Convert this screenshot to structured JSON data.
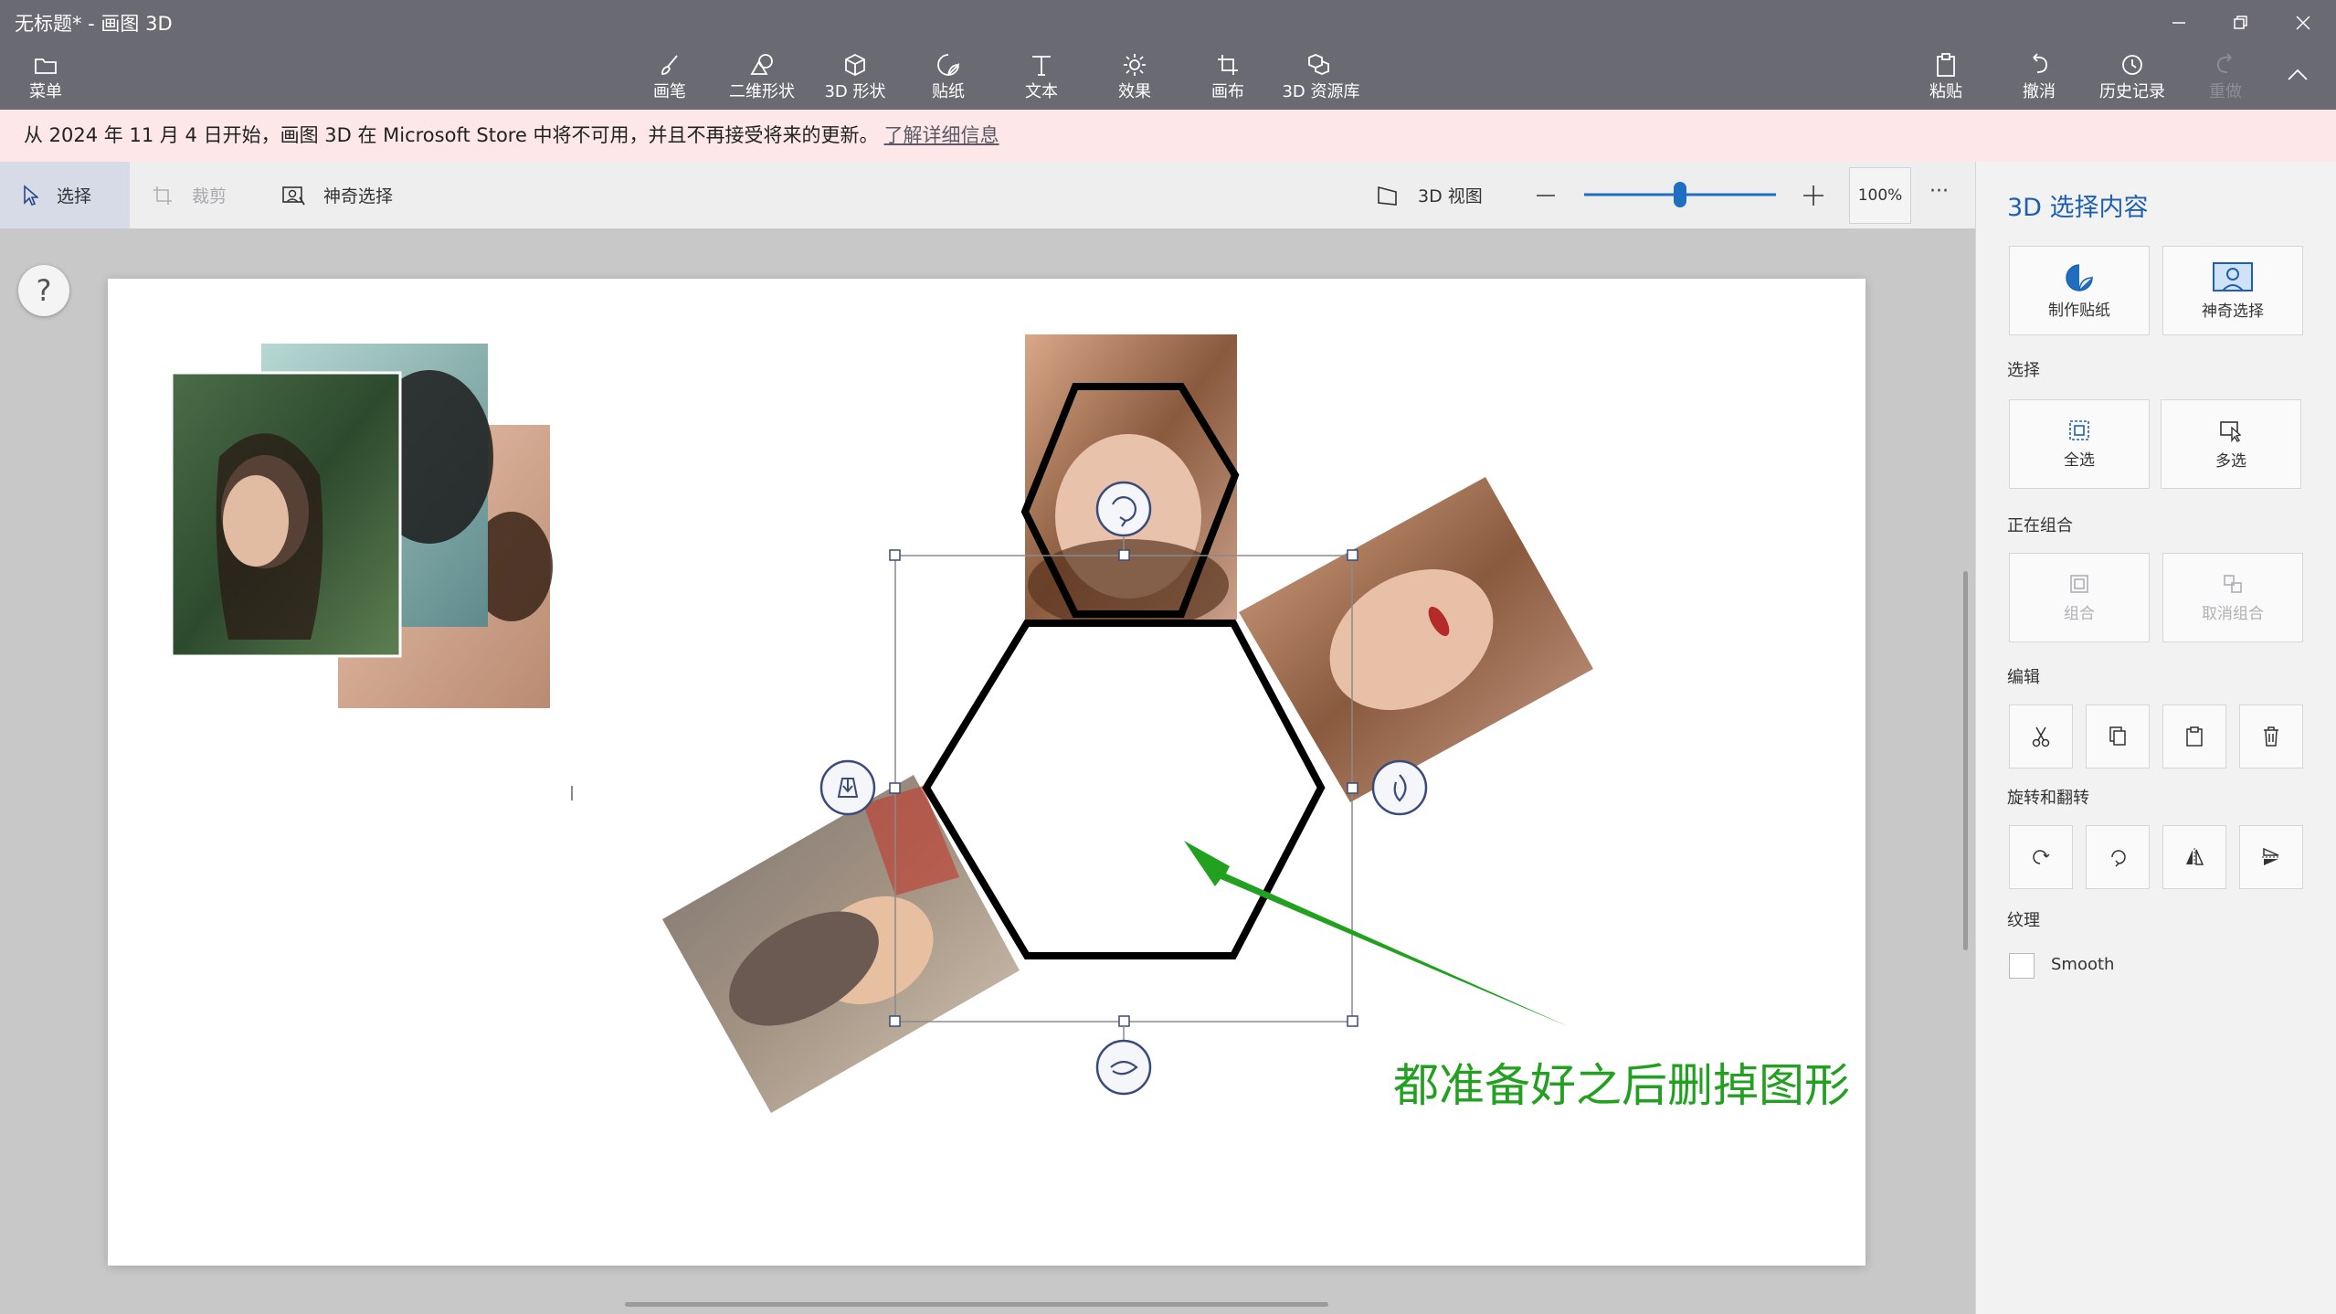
{
  "window": {
    "title": "无标题* - 画图 3D"
  },
  "ribbon": {
    "menu": "菜单",
    "tools": [
      "画笔",
      "二维形状",
      "3D 形状",
      "贴纸",
      "文本",
      "效果",
      "画布",
      "3D 资源库"
    ],
    "paste": "粘贴",
    "undo": "撤消",
    "history": "历史记录",
    "redo": "重做"
  },
  "notice": {
    "text": "从 2024 年 11 月 4 日开始，画图 3D 在 Microsoft Store 中将不可用，并且不再接受将来的更新。",
    "link": "了解详细信息"
  },
  "subtoolbar": {
    "select": "选择",
    "crop": "裁剪",
    "magic_select": "神奇选择",
    "view3d": "3D 视图",
    "zoom_percent": "100%",
    "zoom_level": 0.5,
    "more": "···"
  },
  "canvas": {
    "help": "?",
    "annotation": "都准备好之后删掉图形"
  },
  "panel": {
    "title": "3D 选择内容",
    "make_sticker": "制作贴纸",
    "magic_select": "神奇选择",
    "section_select": "选择",
    "select_all": "全选",
    "multi_select": "多选",
    "section_group": "正在组合",
    "group": "组合",
    "ungroup": "取消组合",
    "section_edit": "编辑",
    "section_rotate": "旋转和翻转",
    "section_texture": "纹理",
    "smooth": "Smooth"
  },
  "colors": {
    "ribbon": "#6a6a72",
    "accent": "#1f5fb0",
    "notice_bg": "#fde7e9",
    "annotation": "#22a020"
  }
}
